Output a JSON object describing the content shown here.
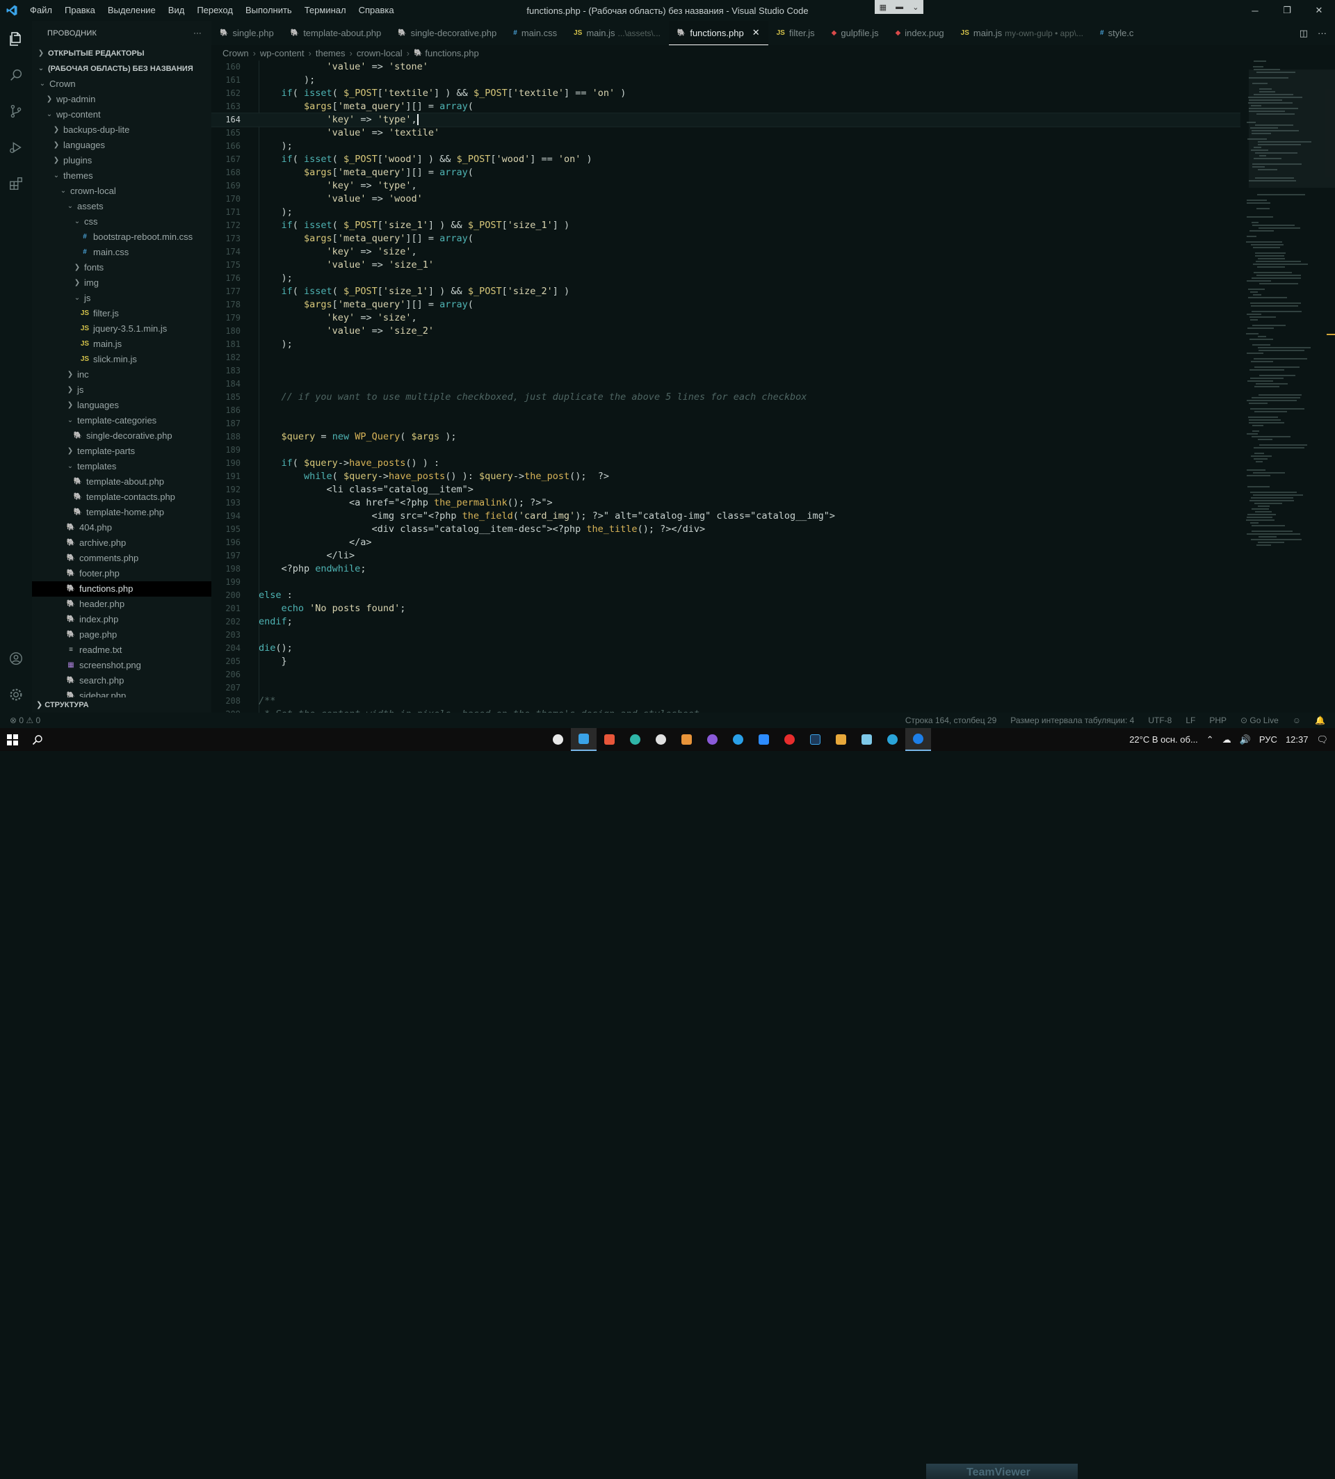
{
  "titlebar": {
    "logo": "vscode-logo",
    "menu": [
      "Файл",
      "Правка",
      "Выделение",
      "Вид",
      "Переход",
      "Выполнить",
      "Терминал",
      "Справка"
    ],
    "title": "functions.php - (Рабочая область) без названия - Visual Studio Code"
  },
  "sidebar": {
    "title": "ПРОВОДНИК",
    "more": "···",
    "open_editors": "ОТКРЫТЫЕ РЕДАКТОРЫ",
    "workspace": "(РАБОЧАЯ ОБЛАСТЬ) БЕЗ НАЗВАНИЯ",
    "structure": "СТРУКТУРА",
    "tree": [
      {
        "label": "Crown",
        "depth": 1,
        "chev": "v",
        "type": "folder"
      },
      {
        "label": "wp-admin",
        "depth": 2,
        "chev": ">",
        "type": "folder"
      },
      {
        "label": "wp-content",
        "depth": 2,
        "chev": "v",
        "type": "folder"
      },
      {
        "label": "backups-dup-lite",
        "depth": 3,
        "chev": ">",
        "type": "folder"
      },
      {
        "label": "languages",
        "depth": 3,
        "chev": ">",
        "type": "folder"
      },
      {
        "label": "plugins",
        "depth": 3,
        "chev": ">",
        "type": "folder"
      },
      {
        "label": "themes",
        "depth": 3,
        "chev": "v",
        "type": "folder"
      },
      {
        "label": "crown-local",
        "depth": 4,
        "chev": "v",
        "type": "folder"
      },
      {
        "label": "assets",
        "depth": 5,
        "chev": "v",
        "type": "folder"
      },
      {
        "label": "css",
        "depth": 6,
        "chev": "v",
        "type": "folder"
      },
      {
        "label": "bootstrap-reboot.min.css",
        "depth": 7,
        "icon": "#",
        "cls": "css"
      },
      {
        "label": "main.css",
        "depth": 7,
        "icon": "#",
        "cls": "css"
      },
      {
        "label": "fonts",
        "depth": 6,
        "chev": ">",
        "type": "folder"
      },
      {
        "label": "img",
        "depth": 6,
        "chev": ">",
        "type": "folder"
      },
      {
        "label": "js",
        "depth": 6,
        "chev": "v",
        "type": "folder"
      },
      {
        "label": "filter.js",
        "depth": 7,
        "icon": "JS",
        "cls": "js"
      },
      {
        "label": "jquery-3.5.1.min.js",
        "depth": 7,
        "icon": "JS",
        "cls": "js"
      },
      {
        "label": "main.js",
        "depth": 7,
        "icon": "JS",
        "cls": "js"
      },
      {
        "label": "slick.min.js",
        "depth": 7,
        "icon": "JS",
        "cls": "js"
      },
      {
        "label": "inc",
        "depth": 5,
        "chev": ">",
        "type": "folder"
      },
      {
        "label": "js",
        "depth": 5,
        "chev": ">",
        "type": "folder"
      },
      {
        "label": "languages",
        "depth": 5,
        "chev": ">",
        "type": "folder"
      },
      {
        "label": "template-categories",
        "depth": 5,
        "chev": "v",
        "type": "folder"
      },
      {
        "label": "single-decorative.php",
        "depth": 6,
        "icon": "🐘",
        "cls": "php"
      },
      {
        "label": "template-parts",
        "depth": 5,
        "chev": ">",
        "type": "folder"
      },
      {
        "label": "templates",
        "depth": 5,
        "chev": "v",
        "type": "folder"
      },
      {
        "label": "template-about.php",
        "depth": 6,
        "icon": "🐘",
        "cls": "php"
      },
      {
        "label": "template-contacts.php",
        "depth": 6,
        "icon": "🐘",
        "cls": "php"
      },
      {
        "label": "template-home.php",
        "depth": 6,
        "icon": "🐘",
        "cls": "php"
      },
      {
        "label": "404.php",
        "depth": 5,
        "icon": "🐘",
        "cls": "php"
      },
      {
        "label": "archive.php",
        "depth": 5,
        "icon": "🐘",
        "cls": "php"
      },
      {
        "label": "comments.php",
        "depth": 5,
        "icon": "🐘",
        "cls": "php"
      },
      {
        "label": "footer.php",
        "depth": 5,
        "icon": "🐘",
        "cls": "php"
      },
      {
        "label": "functions.php",
        "depth": 5,
        "icon": "🐘",
        "cls": "php",
        "active": true
      },
      {
        "label": "header.php",
        "depth": 5,
        "icon": "🐘",
        "cls": "php"
      },
      {
        "label": "index.php",
        "depth": 5,
        "icon": "🐘",
        "cls": "php"
      },
      {
        "label": "page.php",
        "depth": 5,
        "icon": "🐘",
        "cls": "php"
      },
      {
        "label": "readme.txt",
        "depth": 5,
        "icon": "≡",
        "cls": "txt"
      },
      {
        "label": "screenshot.png",
        "depth": 5,
        "icon": "▦",
        "cls": "png"
      },
      {
        "label": "search.php",
        "depth": 5,
        "icon": "🐘",
        "cls": "php"
      },
      {
        "label": "sidebar.php",
        "depth": 5,
        "icon": "🐘",
        "cls": "php"
      }
    ]
  },
  "tabs": [
    {
      "label": "single.php",
      "icon": "🐘",
      "cls": "php"
    },
    {
      "label": "template-about.php",
      "icon": "🐘",
      "cls": "php"
    },
    {
      "label": "single-decorative.php",
      "icon": "🐘",
      "cls": "php"
    },
    {
      "label": "main.css",
      "icon": "#",
      "cls": "css"
    },
    {
      "label": "main.js",
      "sub": "...\\assets\\...",
      "icon": "JS",
      "cls": "js"
    },
    {
      "label": "functions.php",
      "icon": "🐘",
      "cls": "php",
      "active": true,
      "close": "✕"
    },
    {
      "label": "filter.js",
      "icon": "JS",
      "cls": "js"
    },
    {
      "label": "gulpfile.js",
      "icon": "◆",
      "cls": "gulp"
    },
    {
      "label": "index.pug",
      "icon": "◆",
      "cls": "pug"
    },
    {
      "label": "main.js",
      "sub": "my-own-gulp • app\\...",
      "icon": "JS",
      "cls": "js"
    },
    {
      "label": "style.c",
      "icon": "#",
      "cls": "css"
    }
  ],
  "breadcrumbs": [
    "Crown",
    "wp-content",
    "themes",
    "crown-local",
    "functions.php"
  ],
  "editor": {
    "cursor_line": 164,
    "lines": [
      {
        "n": 160,
        "code": "            'value' => 'stone'"
      },
      {
        "n": 161,
        "code": "        );"
      },
      {
        "n": 162,
        "code": "    if( isset( $_POST['textile'] ) && $_POST['textile'] == 'on' )"
      },
      {
        "n": 163,
        "code": "        $args['meta_query'][] = array("
      },
      {
        "n": 164,
        "code": "            'key' => 'type',"
      },
      {
        "n": 165,
        "code": "            'value' => 'textile'"
      },
      {
        "n": 166,
        "code": "    );"
      },
      {
        "n": 167,
        "code": "    if( isset( $_POST['wood'] ) && $_POST['wood'] == 'on' )"
      },
      {
        "n": 168,
        "code": "        $args['meta_query'][] = array("
      },
      {
        "n": 169,
        "code": "            'key' => 'type',"
      },
      {
        "n": 170,
        "code": "            'value' => 'wood'"
      },
      {
        "n": 171,
        "code": "    );"
      },
      {
        "n": 172,
        "code": "    if( isset( $_POST['size_1'] ) && $_POST['size_1'] )"
      },
      {
        "n": 173,
        "code": "        $args['meta_query'][] = array("
      },
      {
        "n": 174,
        "code": "            'key' => 'size',"
      },
      {
        "n": 175,
        "code": "            'value' => 'size_1'"
      },
      {
        "n": 176,
        "code": "    );"
      },
      {
        "n": 177,
        "code": "    if( isset( $_POST['size_1'] ) && $_POST['size_2'] )"
      },
      {
        "n": 178,
        "code": "        $args['meta_query'][] = array("
      },
      {
        "n": 179,
        "code": "            'key' => 'size',"
      },
      {
        "n": 180,
        "code": "            'value' => 'size_2'"
      },
      {
        "n": 181,
        "code": "    );"
      },
      {
        "n": 182,
        "code": ""
      },
      {
        "n": 183,
        "code": ""
      },
      {
        "n": 184,
        "code": ""
      },
      {
        "n": 185,
        "code": "    // if you want to use multiple checkboxed, just duplicate the above 5 lines for each checkbox",
        "cls": "k-cm"
      },
      {
        "n": 186,
        "code": ""
      },
      {
        "n": 187,
        "code": ""
      },
      {
        "n": 188,
        "code": "    $query = new WP_Query( $args );"
      },
      {
        "n": 189,
        "code": ""
      },
      {
        "n": 190,
        "code": "    if( $query->have_posts() ) :"
      },
      {
        "n": 191,
        "code": "        while( $query->have_posts() ): $query->the_post();  ?>"
      },
      {
        "n": 192,
        "code": "            <li class=\"catalog__item\">"
      },
      {
        "n": 193,
        "code": "                <a href=\"<?php the_permalink(); ?>\">"
      },
      {
        "n": 194,
        "code": "                    <img src=\"<?php the_field('card_img'); ?>\" alt=\"catalog-img\" class=\"catalog__img\">"
      },
      {
        "n": 195,
        "code": "                    <div class=\"catalog__item-desc\"><?php the_title(); ?></div>"
      },
      {
        "n": 196,
        "code": "                </a>"
      },
      {
        "n": 197,
        "code": "            </li>"
      },
      {
        "n": 198,
        "code": "    <?php endwhile;"
      },
      {
        "n": 199,
        "code": ""
      },
      {
        "n": 200,
        "code": "else :"
      },
      {
        "n": 201,
        "code": "    echo 'No posts found';"
      },
      {
        "n": 202,
        "code": "endif;"
      },
      {
        "n": 203,
        "code": ""
      },
      {
        "n": 204,
        "code": "die();"
      },
      {
        "n": 205,
        "code": "    }"
      },
      {
        "n": 206,
        "code": ""
      },
      {
        "n": 207,
        "code": ""
      },
      {
        "n": 208,
        "code": "/**",
        "cls": "k-cm"
      },
      {
        "n": 209,
        "code": " * Set the content width in pixels, based on the theme's design and stylesheet",
        "cls": "k-cm"
      }
    ]
  },
  "status": {
    "problems": "⊗ 0 ⚠ 0",
    "position": "Строка 164, столбец 29",
    "tabsize": "Размер интервала табуляции: 4",
    "encoding": "UTF-8",
    "eol": "LF",
    "lang": "PHP",
    "golive": "⊙ Go Live"
  },
  "taskbar": {
    "weather": "22°C  В осн. об...",
    "lang": "РУС",
    "time": "12:37",
    "preview": "TeamViewer"
  },
  "colors": {
    "accent": "#3aa3e8",
    "bg": "#0a1414"
  }
}
